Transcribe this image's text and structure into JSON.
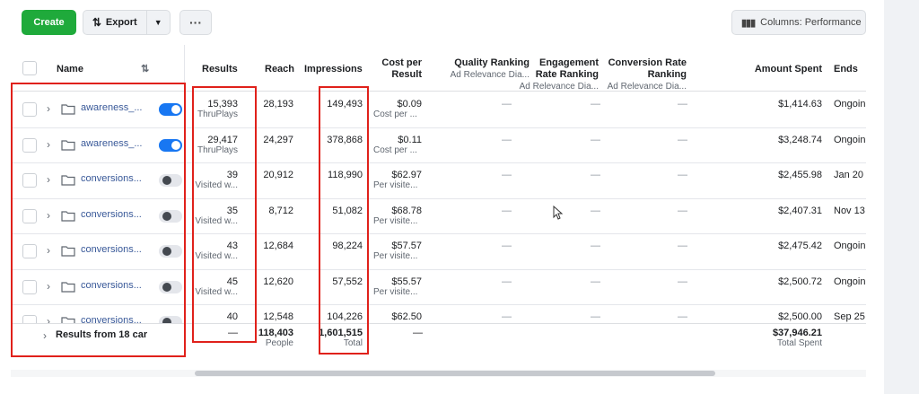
{
  "toolbar": {
    "create_label": "Create",
    "export_label": "Export",
    "more_label": "···",
    "columns_label": "Columns: Performance"
  },
  "header": {
    "name": "Name",
    "results": "Results",
    "reach": "Reach",
    "impressions": "Impressions",
    "cost_per_result_line1": "Cost per",
    "cost_per_result_line2": "Result",
    "quality_ranking": "Quality Ranking",
    "quality_ranking_sub": "Ad Relevance Dia...",
    "engagement_line1": "Engagement",
    "engagement_line2": "Rate Ranking",
    "engagement_sub": "Ad Relevance Dia...",
    "conversion_line1": "Conversion Rate",
    "conversion_line2": "Ranking",
    "conversion_sub": "Ad Relevance Dia...",
    "amount_spent": "Amount Spent",
    "ends": "Ends"
  },
  "rows": [
    {
      "name": "awareness_...",
      "on": true,
      "results": "15,393",
      "results_sub": "ThruPlays",
      "reach": "28,193",
      "impressions": "149,493",
      "cost": "$0.09",
      "cost_sub": "Cost per ...",
      "quality": "—",
      "engagement": "—",
      "conversion": "—",
      "spent": "$1,414.63",
      "ends": "Ongoin"
    },
    {
      "name": "awareness_...",
      "on": true,
      "results": "29,417",
      "results_sub": "ThruPlays",
      "reach": "24,297",
      "impressions": "378,868",
      "cost": "$0.11",
      "cost_sub": "Cost per ...",
      "quality": "—",
      "engagement": "—",
      "conversion": "—",
      "spent": "$3,248.74",
      "ends": "Ongoin"
    },
    {
      "name": "conversions...",
      "on": false,
      "results": "39",
      "results_sub": "Visited w...",
      "reach": "20,912",
      "impressions": "118,990",
      "cost": "$62.97",
      "cost_sub": "Per visite...",
      "quality": "—",
      "engagement": "—",
      "conversion": "—",
      "spent": "$2,455.98",
      "ends": "Jan 20"
    },
    {
      "name": "conversions...",
      "on": false,
      "results": "35",
      "results_sub": "Visited w...",
      "reach": "8,712",
      "impressions": "51,082",
      "cost": "$68.78",
      "cost_sub": "Per visite...",
      "quality": "—",
      "engagement": "—",
      "conversion": "—",
      "spent": "$2,407.31",
      "ends": "Nov 13"
    },
    {
      "name": "conversions...",
      "on": false,
      "results": "43",
      "results_sub": "Visited w...",
      "reach": "12,684",
      "impressions": "98,224",
      "cost": "$57.57",
      "cost_sub": "Per visite...",
      "quality": "—",
      "engagement": "—",
      "conversion": "—",
      "spent": "$2,475.42",
      "ends": "Ongoin"
    },
    {
      "name": "conversions...",
      "on": false,
      "results": "45",
      "results_sub": "Visited w...",
      "reach": "12,620",
      "impressions": "57,552",
      "cost": "$55.57",
      "cost_sub": "Per visite...",
      "quality": "—",
      "engagement": "—",
      "conversion": "—",
      "spent": "$2,500.72",
      "ends": "Ongoin"
    },
    {
      "name": "conversions...",
      "on": false,
      "results": "40",
      "results_sub": "",
      "reach": "12,548",
      "impressions": "104,226",
      "cost": "$62.50",
      "cost_sub": "",
      "quality": "—",
      "engagement": "—",
      "conversion": "—",
      "spent": "$2,500.00",
      "ends": "Sep 25"
    }
  ],
  "footer": {
    "label": "Results from 18 car",
    "results": "—",
    "reach": "118,403",
    "reach_sub": "People",
    "impressions": "1,601,515",
    "impressions_sub": "Total",
    "cost": "—",
    "spent": "$37,946.21",
    "spent_sub": "Total Spent"
  },
  "colors": {
    "create_green": "#1faa3b",
    "link_blue": "#385898",
    "toggle_blue": "#1877f2",
    "highlight_red": "#e0211b"
  }
}
